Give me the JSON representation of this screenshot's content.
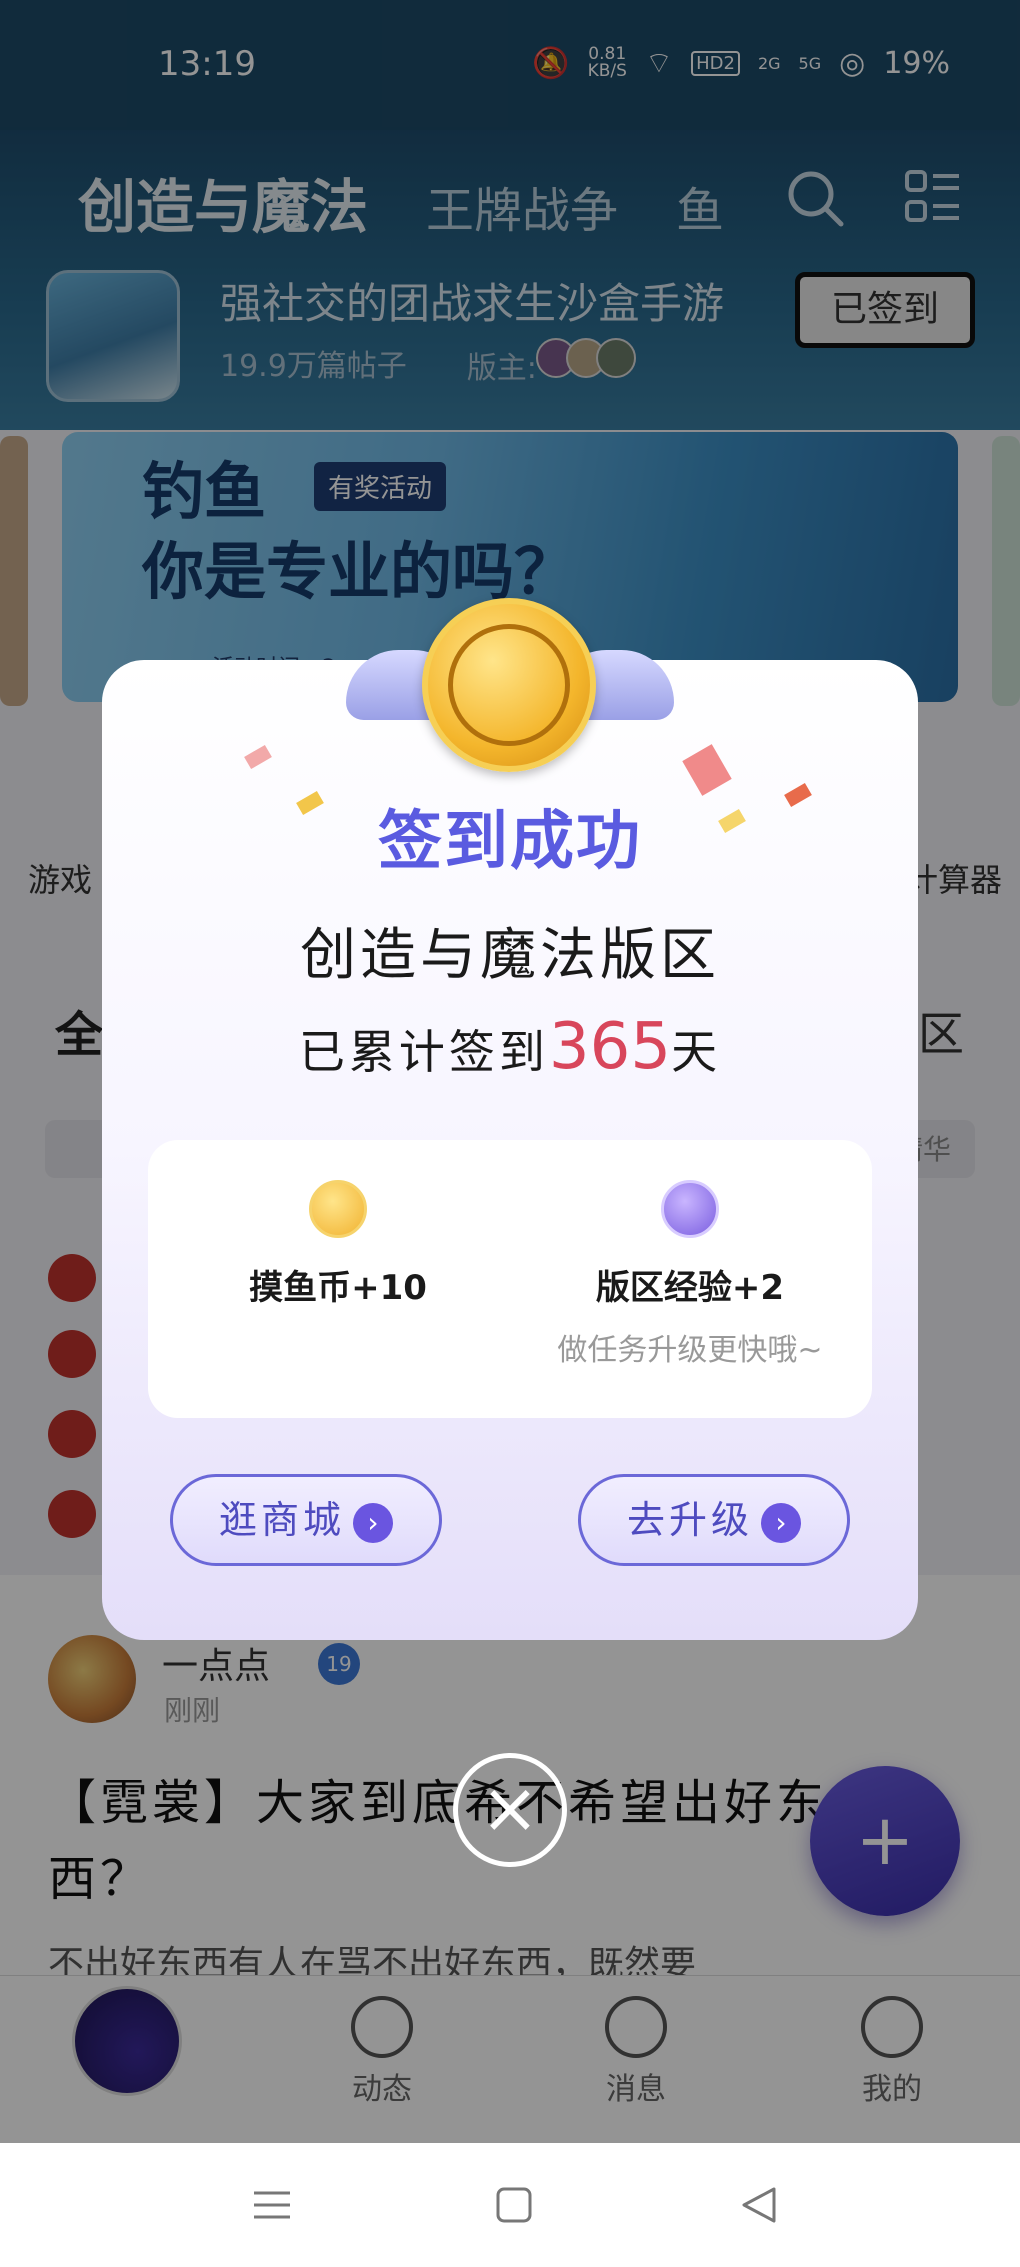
{
  "status_bar": {
    "time": "13:19",
    "net_speed": "0.81",
    "net_unit": "KB/S",
    "hd": "HD2",
    "sig1": "2G",
    "sig2": "5G",
    "battery": "19%"
  },
  "header": {
    "tabs": [
      "创造与魔法",
      "王牌战争",
      "鱼"
    ],
    "forum_slogan": "强社交的团战求生沙盒手游",
    "post_count": "19.9万篇帖子",
    "moderators_label": "版主:",
    "signed_button": "已签到"
  },
  "banner": {
    "line1": "钓鱼",
    "line2": "你是专业的吗？",
    "tag": "有奖活动",
    "time": "活动时间：2"
  },
  "quick_links": {
    "left": "游戏",
    "right": "计算器"
  },
  "feed": {
    "tab_left": "全",
    "tab_right": "区",
    "chip_right": "精华"
  },
  "post": {
    "author": "一点点",
    "level": "19",
    "time": "刚刚",
    "title": "【霓裳】大家到底希不希望出好东西？",
    "body": "不出好东西有人在骂不出好东西，既然要"
  },
  "tabbar": {
    "home": "",
    "feed": "动态",
    "messages": "消息",
    "me": "我的"
  },
  "modal": {
    "title": "签到成功",
    "forum_name": "创造与魔法版区",
    "count_prefix": "已累计签到",
    "count": "365",
    "count_suffix": "天",
    "rewards": [
      {
        "label": "摸鱼币+10",
        "hint": ""
      },
      {
        "label": "版区经验+2",
        "hint": "做任务升级更快哦~"
      }
    ],
    "shop_button": "逛商城",
    "upgrade_button": "去升级"
  },
  "colors": {
    "accent": "#5a5be0",
    "count": "#d8465b"
  }
}
